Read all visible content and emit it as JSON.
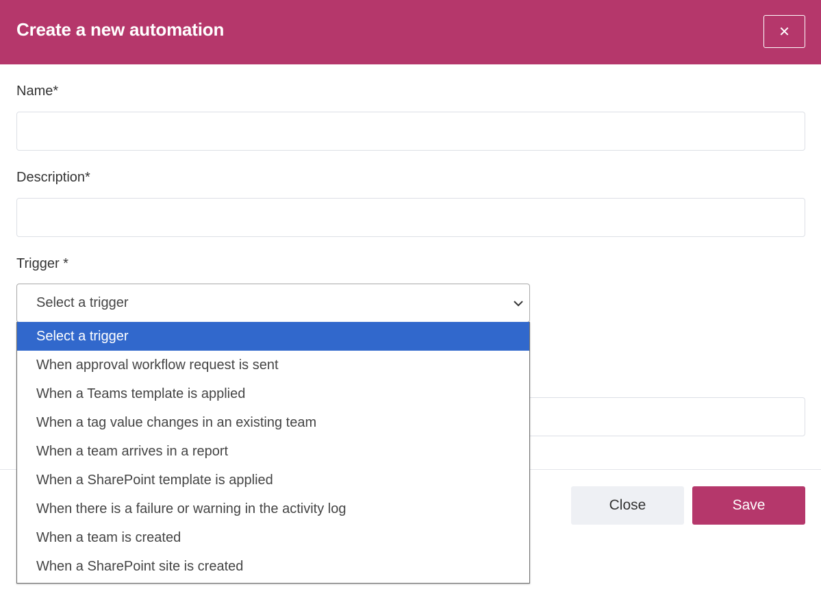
{
  "modal": {
    "title": "Create a new automation",
    "close_icon": "close-icon"
  },
  "form": {
    "name_label": "Name*",
    "name_value": "",
    "description_label": "Description*",
    "description_value": "",
    "trigger_label": "Trigger *",
    "trigger_selected": "Select a trigger",
    "trigger_options": [
      "Select a trigger",
      "When approval workflow request is sent",
      "When a Teams template is applied",
      "When a tag value changes in an existing team",
      "When a team arrives in a report",
      "When a SharePoint template is applied",
      "When there is a failure or warning in the activity log",
      "When a team is created",
      "When a SharePoint site is created"
    ],
    "highlighted_option_index": 0
  },
  "footer": {
    "close_label": "Close",
    "save_label": "Save"
  },
  "colors": {
    "brand": "#b5376b",
    "highlight": "#3168cc",
    "secondary_button": "#eef0f4"
  }
}
